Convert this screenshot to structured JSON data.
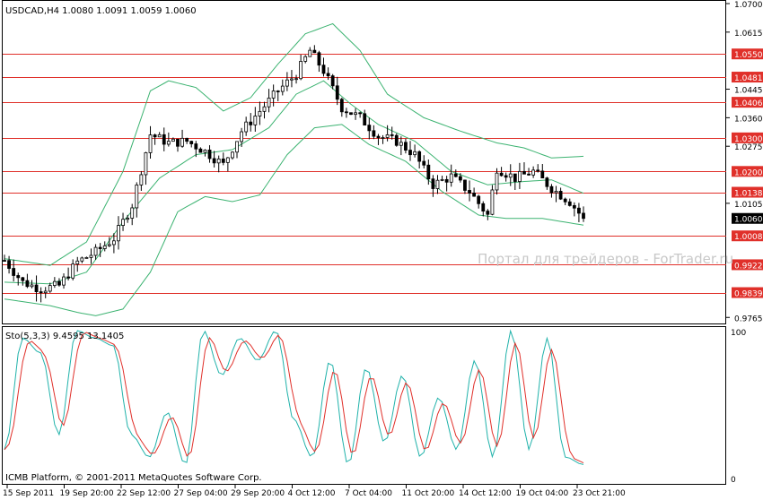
{
  "chart_data": [
    {
      "type": "candlestick",
      "header": "USDCAD,H4  1.0080 1.0091 1.0059 1.0060",
      "symbol": "USDCAD",
      "timeframe": "H4",
      "last_ohlc": {
        "open": 1.008,
        "high": 1.0091,
        "low": 1.0059,
        "close": 1.006
      },
      "watermark": "Портал для трейдеров - ForTrader.ru",
      "y_ticks": [
        "1.0700",
        "1.0615",
        "1.0550",
        "1.0481",
        "1.0445",
        "1.0406",
        "1.0360",
        "1.0300",
        "1.0275",
        "1.0200",
        "1.0138",
        "1.0105",
        "1.0060",
        "1.0008",
        "0.9922",
        "0.9839",
        "0.9765"
      ],
      "ylim": [
        0.9755,
        1.07
      ],
      "current_price": "1.0060",
      "horizontal_levels": [
        {
          "value": 1.055,
          "label": "1.0550"
        },
        {
          "value": 1.0481,
          "label": "1.0481"
        },
        {
          "value": 1.0406,
          "label": "1.0406"
        },
        {
          "value": 1.03,
          "label": "1.0300"
        },
        {
          "value": 1.02,
          "label": "1.0200"
        },
        {
          "value": 1.0138,
          "label": "1.0138"
        },
        {
          "value": 1.0008,
          "label": "1.0008"
        },
        {
          "value": 0.9922,
          "label": "0.9922"
        },
        {
          "value": 0.9839,
          "label": "0.9839"
        }
      ],
      "x_tick_labels": [
        "15 Sep 2011",
        "19 Sep 20:00",
        "22 Sep 12:00",
        "27 Sep 04:00",
        "29 Sep 20:00",
        "4 Oct 12:00",
        "7 Oct 04:00",
        "11 Oct 20:00",
        "14 Oct 12:00",
        "19 Oct 04:00",
        "23 Oct 21:00"
      ],
      "candle_count": 108,
      "price_path": [
        [
          0,
          0.9935
        ],
        [
          4,
          0.987
        ],
        [
          8,
          0.985
        ],
        [
          12,
          0.986
        ],
        [
          16,
          0.993
        ],
        [
          20,
          0.996
        ],
        [
          24,
          1.0
        ],
        [
          28,
          1.01
        ],
        [
          32,
          1.031
        ],
        [
          36,
          1.0285
        ],
        [
          40,
          1.029
        ],
        [
          44,
          1.026
        ],
        [
          48,
          1.022
        ],
        [
          52,
          1.032
        ],
        [
          56,
          1.038
        ],
        [
          60,
          1.044
        ],
        [
          64,
          1.049
        ],
        [
          67,
          1.056
        ],
        [
          70,
          1.05
        ],
        [
          74,
          1.039
        ],
        [
          78,
          1.036
        ],
        [
          82,
          1.0305
        ],
        [
          86,
          1.029
        ],
        [
          90,
          1.025
        ],
        [
          94,
          1.016
        ],
        [
          98,
          1.0185
        ],
        [
          102,
          1.014
        ],
        [
          106,
          1.007
        ],
        [
          108,
          1.021
        ],
        [
          112,
          1.018
        ],
        [
          116,
          1.02
        ],
        [
          120,
          1.015
        ],
        [
          124,
          1.011
        ],
        [
          127,
          1.006
        ]
      ],
      "bollinger": {
        "middle_path": [
          [
            0,
            0.987
          ],
          [
            10,
            0.9865
          ],
          [
            18,
            0.99
          ],
          [
            26,
            1.005
          ],
          [
            34,
            1.018
          ],
          [
            42,
            1.025
          ],
          [
            50,
            1.0265
          ],
          [
            58,
            1.033
          ],
          [
            64,
            1.043
          ],
          [
            70,
            1.047
          ],
          [
            76,
            1.04
          ],
          [
            82,
            1.034
          ],
          [
            90,
            1.029
          ],
          [
            98,
            1.02
          ],
          [
            106,
            1.016
          ],
          [
            114,
            1.017
          ],
          [
            120,
            1.0175
          ],
          [
            127,
            1.0135
          ]
        ],
        "upper_path": [
          [
            0,
            0.994
          ],
          [
            10,
            0.992
          ],
          [
            18,
            0.999
          ],
          [
            26,
            1.02
          ],
          [
            32,
            1.044
          ],
          [
            36,
            1.047
          ],
          [
            42,
            1.045
          ],
          [
            48,
            1.038
          ],
          [
            54,
            1.042
          ],
          [
            60,
            1.052
          ],
          [
            66,
            1.061
          ],
          [
            72,
            1.064
          ],
          [
            78,
            1.056
          ],
          [
            84,
            1.043
          ],
          [
            92,
            1.036
          ],
          [
            100,
            1.032
          ],
          [
            108,
            1.0285
          ],
          [
            114,
            1.027
          ],
          [
            120,
            1.024
          ],
          [
            127,
            1.0245
          ]
        ],
        "lower_path": [
          [
            0,
            0.982
          ],
          [
            10,
            0.98
          ],
          [
            16,
            0.978
          ],
          [
            20,
            0.977
          ],
          [
            26,
            0.979
          ],
          [
            32,
            0.99
          ],
          [
            38,
            1.008
          ],
          [
            44,
            1.0125
          ],
          [
            50,
            1.011
          ],
          [
            56,
            1.013
          ],
          [
            62,
            1.025
          ],
          [
            68,
            1.033
          ],
          [
            74,
            1.034
          ],
          [
            80,
            1.028
          ],
          [
            88,
            1.023
          ],
          [
            96,
            1.014
          ],
          [
            104,
            1.007
          ],
          [
            110,
            1.006
          ],
          [
            118,
            1.006
          ],
          [
            127,
            1.004
          ]
        ]
      }
    },
    {
      "type": "line",
      "header": "Sto(5,3,3) 9.4595 13.1405",
      "indicator": "Sto(5,3,3)",
      "main_value": "9.4595",
      "signal_value": "13.1405",
      "ylim": [
        0,
        100
      ],
      "y_ticks": [
        "100",
        "0"
      ],
      "series": [
        {
          "name": "Main",
          "color": "#20b2aa"
        },
        {
          "name": "Signal",
          "color": "#e0302a"
        }
      ]
    }
  ],
  "copyright": "ICMB Platform, © 2001-2011 MetaQuotes Software Corp.",
  "colors": {
    "levels": "#e0302a",
    "bollinger": "#3cb371",
    "stoch_main": "#20b2aa",
    "stoch_signal": "#e0302a",
    "axis": "#000000",
    "label_box": "#e0302a"
  }
}
